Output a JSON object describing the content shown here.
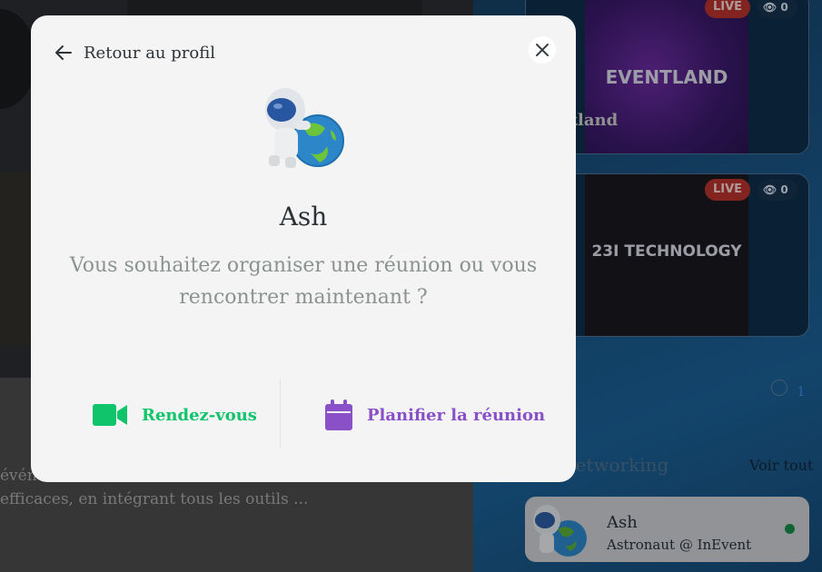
{
  "background": {
    "description_text": "efficaces, en intégrant tous les outils ...",
    "description_fragment": "événe",
    "live_events": [
      {
        "thumb_text": "EVENTLAND",
        "title": "Eventland",
        "live_label": "LIVE",
        "viewers": "0"
      },
      {
        "thumb_text": "23I TECHNOLOGY",
        "live_label": "LIVE",
        "viewers": "0"
      }
    ],
    "pager": "1",
    "networking": {
      "title": "Networking",
      "see_all_label": "Voir tout",
      "attendee": {
        "name": "Ash",
        "role": "Astronaut @ InEvent",
        "status_color": "#1a8a47"
      }
    }
  },
  "modal": {
    "back_label": "Retour au profil",
    "back_icon": "arrow-left-icon",
    "close_icon": "close-icon",
    "user_name": "Ash",
    "question": "Vous souhaitez organiser une réunion ou vous rencontrer maintenant ?",
    "actions": {
      "meet_label": "Rendez-vous",
      "meet_icon": "video-camera-icon",
      "meet_color": "#10c46c",
      "schedule_label": "Planifier la réunion",
      "schedule_icon": "calendar-icon",
      "schedule_color": "#8a50c8"
    }
  }
}
